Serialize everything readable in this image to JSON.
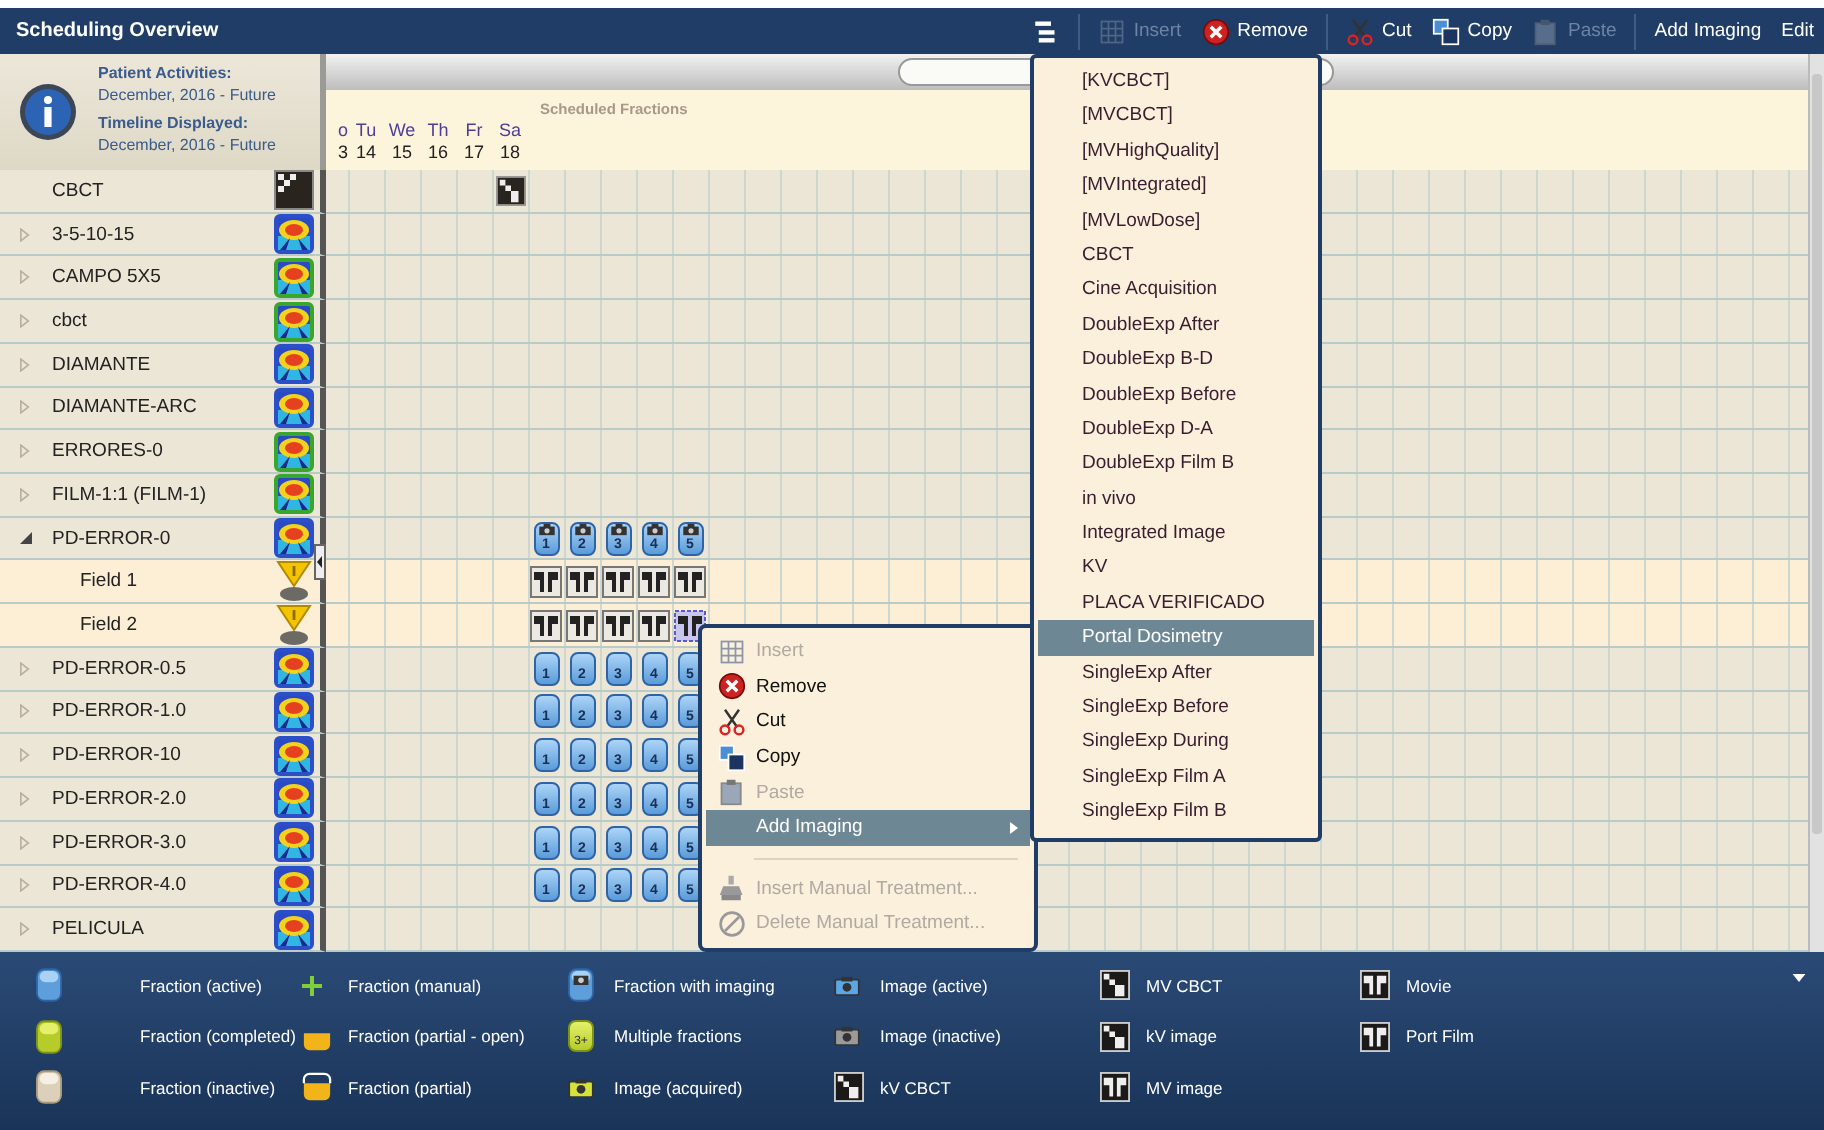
{
  "window": {
    "title": "Scheduling Overview"
  },
  "toolbar": [
    {
      "kind": "menu"
    },
    {
      "kind": "insert",
      "label": "Insert",
      "disabled": true
    },
    {
      "kind": "remove",
      "label": "Remove",
      "disabled": false
    },
    {
      "kind": "cut",
      "label": "Cut",
      "disabled": false
    },
    {
      "kind": "copy",
      "label": "Copy",
      "disabled": false
    },
    {
      "kind": "paste",
      "label": "Paste",
      "disabled": true
    },
    {
      "kind": "add-imaging",
      "label": "Add Imaging",
      "disabled": false
    },
    {
      "kind": "edit",
      "label": "Edit",
      "disabled": false
    }
  ],
  "info": [
    {
      "kind": "heading",
      "text": "Patient Activities:"
    },
    {
      "kind": "value",
      "text": "December, 2016 - Future"
    },
    {
      "kind": "heading",
      "text": "Timeline Displayed:"
    },
    {
      "kind": "value",
      "text": "December, 2016 - Future"
    }
  ],
  "timeline": {
    "title": "Scheduled Fractions",
    "days": [
      {
        "day": "o",
        "date": "3"
      },
      {
        "day": "Tu",
        "date": "14"
      },
      {
        "day": "We",
        "date": "15"
      },
      {
        "day": "Th",
        "date": "16"
      },
      {
        "day": "Fr",
        "date": "17"
      },
      {
        "day": "Sa",
        "date": "18"
      }
    ]
  },
  "rows": [
    {
      "name": "CBCT",
      "kind": "scan",
      "markers": [
        {
          "kind": "kv-cbct"
        }
      ]
    },
    {
      "name": "3-5-10-15",
      "kind": "plan",
      "color": "#2b4fc8",
      "expanded": false
    },
    {
      "name": "CAMPO 5X5",
      "kind": "plan",
      "color": "#3aa62e",
      "expanded": false
    },
    {
      "name": "cbct",
      "kind": "plan",
      "color": "#3aa62e",
      "expanded": false
    },
    {
      "name": "DIAMANTE",
      "kind": "plan",
      "color": "#2b4fc8",
      "expanded": false
    },
    {
      "name": "DIAMANTE-ARC",
      "kind": "plan",
      "color": "#2b4fc8",
      "expanded": false
    },
    {
      "name": "ERRORES-0",
      "kind": "plan",
      "color": "#3aa62e",
      "expanded": false
    },
    {
      "name": "FILM-1:1 (FILM-1)",
      "kind": "plan",
      "color": "#3aa62e",
      "expanded": false
    },
    {
      "name": "PD-ERROR-0",
      "kind": "plan",
      "color": "#2b4fc8",
      "expanded": true,
      "markers": [
        {
          "kind": "imaging",
          "label": "1"
        },
        {
          "kind": "imaging",
          "label": "2"
        },
        {
          "kind": "imaging",
          "label": "3"
        },
        {
          "kind": "imaging",
          "label": "4"
        },
        {
          "kind": "imaging",
          "label": "5"
        }
      ],
      "children": [
        {
          "name": "Field 1",
          "kind": "field",
          "markers": [
            {
              "kind": "port-film",
              "selected": false
            },
            {
              "kind": "port-film",
              "selected": false
            },
            {
              "kind": "port-film",
              "selected": false
            },
            {
              "kind": "port-film",
              "selected": false
            },
            {
              "kind": "port-film",
              "selected": false
            }
          ]
        },
        {
          "name": "Field 2",
          "kind": "field",
          "markers": [
            {
              "kind": "port-film",
              "selected": false
            },
            {
              "kind": "port-film",
              "selected": false
            },
            {
              "kind": "port-film",
              "selected": false
            },
            {
              "kind": "port-film",
              "selected": false
            },
            {
              "kind": "port-film",
              "selected": true
            }
          ]
        }
      ]
    },
    {
      "name": "PD-ERROR-0.5",
      "kind": "plan",
      "color": "#2b4fc8",
      "expanded": false,
      "markers": [
        {
          "kind": "active",
          "label": "1"
        },
        {
          "kind": "active",
          "label": "2"
        },
        {
          "kind": "active",
          "label": "3"
        },
        {
          "kind": "active",
          "label": "4"
        },
        {
          "kind": "active",
          "label": "5"
        }
      ]
    },
    {
      "name": "PD-ERROR-1.0",
      "kind": "plan",
      "color": "#2b4fc8",
      "expanded": false,
      "markers": [
        {
          "kind": "active",
          "label": "1"
        },
        {
          "kind": "active",
          "label": "2"
        },
        {
          "kind": "active",
          "label": "3"
        },
        {
          "kind": "active",
          "label": "4"
        },
        {
          "kind": "active",
          "label": "5"
        }
      ]
    },
    {
      "name": "PD-ERROR-10",
      "kind": "plan",
      "color": "#2b4fc8",
      "expanded": false,
      "markers": [
        {
          "kind": "active",
          "label": "1"
        },
        {
          "kind": "active",
          "label": "2"
        },
        {
          "kind": "active",
          "label": "3"
        },
        {
          "kind": "active",
          "label": "4"
        },
        {
          "kind": "active",
          "label": "5"
        }
      ]
    },
    {
      "name": "PD-ERROR-2.0",
      "kind": "plan",
      "color": "#2b4fc8",
      "expanded": false,
      "markers": [
        {
          "kind": "active",
          "label": "1"
        },
        {
          "kind": "active",
          "label": "2"
        },
        {
          "kind": "active",
          "label": "3"
        },
        {
          "kind": "active",
          "label": "4"
        },
        {
          "kind": "active",
          "label": "5"
        }
      ]
    },
    {
      "name": "PD-ERROR-3.0",
      "kind": "plan",
      "color": "#2b4fc8",
      "expanded": false,
      "markers": [
        {
          "kind": "active",
          "label": "1"
        },
        {
          "kind": "active",
          "label": "2"
        },
        {
          "kind": "active",
          "label": "3"
        },
        {
          "kind": "active",
          "label": "4"
        },
        {
          "kind": "active",
          "label": "5"
        }
      ]
    },
    {
      "name": "PD-ERROR-4.0",
      "kind": "plan",
      "color": "#2b4fc8",
      "expanded": false,
      "markers": [
        {
          "kind": "active",
          "label": "1"
        },
        {
          "kind": "active",
          "label": "2"
        },
        {
          "kind": "active",
          "label": "3"
        },
        {
          "kind": "active",
          "label": "4"
        },
        {
          "kind": "active",
          "label": "5"
        }
      ]
    },
    {
      "name": "PELICULA",
      "kind": "plan",
      "color": "#2b4fc8",
      "expanded": false
    }
  ],
  "context_menu": {
    "items": [
      {
        "kind": "insert",
        "label": "Insert",
        "disabled": true,
        "selected": false
      },
      {
        "kind": "remove",
        "label": "Remove",
        "disabled": false,
        "selected": false
      },
      {
        "kind": "cut",
        "label": "Cut",
        "disabled": false,
        "selected": false
      },
      {
        "kind": "copy",
        "label": "Copy",
        "disabled": false,
        "selected": false
      },
      {
        "kind": "paste",
        "label": "Paste",
        "disabled": true,
        "selected": false
      },
      {
        "kind": "add-imaging",
        "label": "Add Imaging",
        "disabled": false,
        "selected": true,
        "submenu": true
      },
      {
        "kind": "separator"
      },
      {
        "kind": "insert-manual",
        "label": "Insert Manual Treatment...",
        "disabled": true,
        "selected": false
      },
      {
        "kind": "delete-manual",
        "label": "Delete Manual Treatment...",
        "disabled": true,
        "selected": false
      }
    ]
  },
  "submenu": {
    "items": [
      {
        "label": "[KVCBCT]",
        "selected": false
      },
      {
        "label": "[MVCBCT]",
        "selected": false
      },
      {
        "label": "[MVHighQuality]",
        "selected": false
      },
      {
        "label": "[MVIntegrated]",
        "selected": false
      },
      {
        "label": "[MVLowDose]",
        "selected": false
      },
      {
        "label": "CBCT",
        "selected": false
      },
      {
        "label": "Cine Acquisition",
        "selected": false
      },
      {
        "label": "DoubleExp After",
        "selected": false
      },
      {
        "label": "DoubleExp B-D",
        "selected": false
      },
      {
        "label": "DoubleExp Before",
        "selected": false
      },
      {
        "label": "DoubleExp D-A",
        "selected": false
      },
      {
        "label": "DoubleExp Film B",
        "selected": false
      },
      {
        "label": "in vivo",
        "selected": false
      },
      {
        "label": "Integrated Image",
        "selected": false
      },
      {
        "label": "KV",
        "selected": false
      },
      {
        "label": "PLACA VERIFICADO",
        "selected": false
      },
      {
        "label": "Portal Dosimetry",
        "selected": true
      },
      {
        "label": "SingleExp After",
        "selected": false
      },
      {
        "label": "SingleExp Before",
        "selected": false
      },
      {
        "label": "SingleExp During",
        "selected": false
      },
      {
        "label": "SingleExp Film A",
        "selected": false
      },
      {
        "label": "SingleExp Film B",
        "selected": false
      }
    ]
  },
  "legend": {
    "columns": [
      [
        {
          "kind": "active",
          "label": "Fraction (active)"
        },
        {
          "kind": "completed",
          "label": "Fraction (completed)"
        },
        {
          "kind": "inactive",
          "label": "Fraction (inactive)"
        }
      ],
      [
        {
          "kind": "manual",
          "label": "Fraction (manual)"
        },
        {
          "kind": "partial-open",
          "label": "Fraction (partial - open)"
        },
        {
          "kind": "partial",
          "label": "Fraction (partial)"
        }
      ],
      [
        {
          "kind": "imaging",
          "label": "Fraction with imaging"
        },
        {
          "kind": "multiple",
          "label": "Multiple fractions",
          "badge": "3+"
        },
        {
          "kind": "acquired",
          "label": "Image (acquired)"
        }
      ],
      [
        {
          "kind": "image-active",
          "label": "Image (active)"
        },
        {
          "kind": "image-inactive",
          "label": "Image (inactive)"
        },
        {
          "kind": "kv-cbct",
          "label": "kV CBCT"
        }
      ],
      [
        {
          "kind": "mv-cbct",
          "label": "MV CBCT"
        },
        {
          "kind": "kv-image",
          "label": "kV image"
        },
        {
          "kind": "mv-image",
          "label": "MV image"
        }
      ],
      [
        {
          "kind": "movie",
          "label": "Movie"
        },
        {
          "kind": "port-film",
          "label": "Port Film"
        }
      ]
    ]
  }
}
